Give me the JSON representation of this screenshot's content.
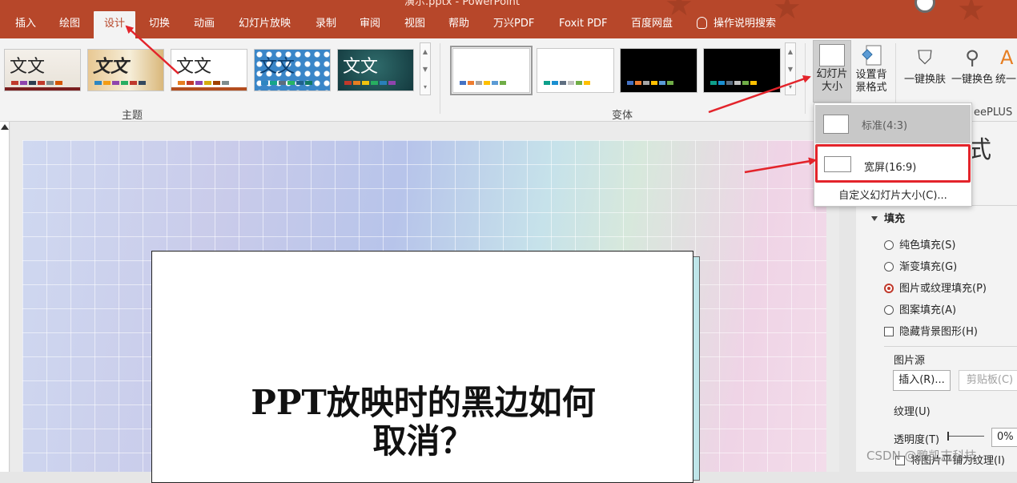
{
  "window": {
    "title_fragment": "演示.pptx - PowerPoint"
  },
  "tabs": [
    {
      "label": "插入"
    },
    {
      "label": "绘图"
    },
    {
      "label": "设计"
    },
    {
      "label": "切换"
    },
    {
      "label": "动画"
    },
    {
      "label": "幻灯片放映"
    },
    {
      "label": "录制"
    },
    {
      "label": "审阅"
    },
    {
      "label": "视图"
    },
    {
      "label": "帮助"
    },
    {
      "label": "万兴PDF"
    },
    {
      "label": "Foxit PDF"
    },
    {
      "label": "百度网盘"
    }
  ],
  "tell_me": "操作说明搜索",
  "ribbon": {
    "themes_group": "主题",
    "variants_group": "变体",
    "theme_sample_text": "文文",
    "slide_size_btn": "幻灯片\n大小",
    "bg_format_btn": "设置背\n景格式",
    "onekey_skin": "一键换肤",
    "onekey_color": "一键换色",
    "unify": "统一",
    "plus_group": "eePLUS"
  },
  "dropdown": {
    "standard": "标准(4:3)",
    "widescreen": "宽屏(16:9)",
    "custom": "自定义幻灯片大小(C)..."
  },
  "slide": {
    "title": "PPT放映时的黑边如何\n取消？"
  },
  "format_pane": {
    "title_fragment": "式",
    "fill_header": "填充",
    "options": [
      {
        "label": "纯色填充(S)",
        "checked": false
      },
      {
        "label": "渐变填充(G)",
        "checked": false
      },
      {
        "label": "图片或纹理填充(P)",
        "checked": true
      },
      {
        "label": "图案填充(A)",
        "checked": false
      }
    ],
    "hide_bg": "隐藏背景图形(H)",
    "picture_source": "图片源",
    "insert_btn": "插入(R)...",
    "clipboard_btn": "剪贴板(C)",
    "texture": "纹理(U)",
    "transparency": "透明度(T)",
    "transparency_value": "0%",
    "tile": "将图片平铺为纹理(I)"
  },
  "watermark": "CSDN @鹏凯志科技",
  "colors": {
    "accent": "#b7472a",
    "highlight_red": "#e3242b"
  }
}
